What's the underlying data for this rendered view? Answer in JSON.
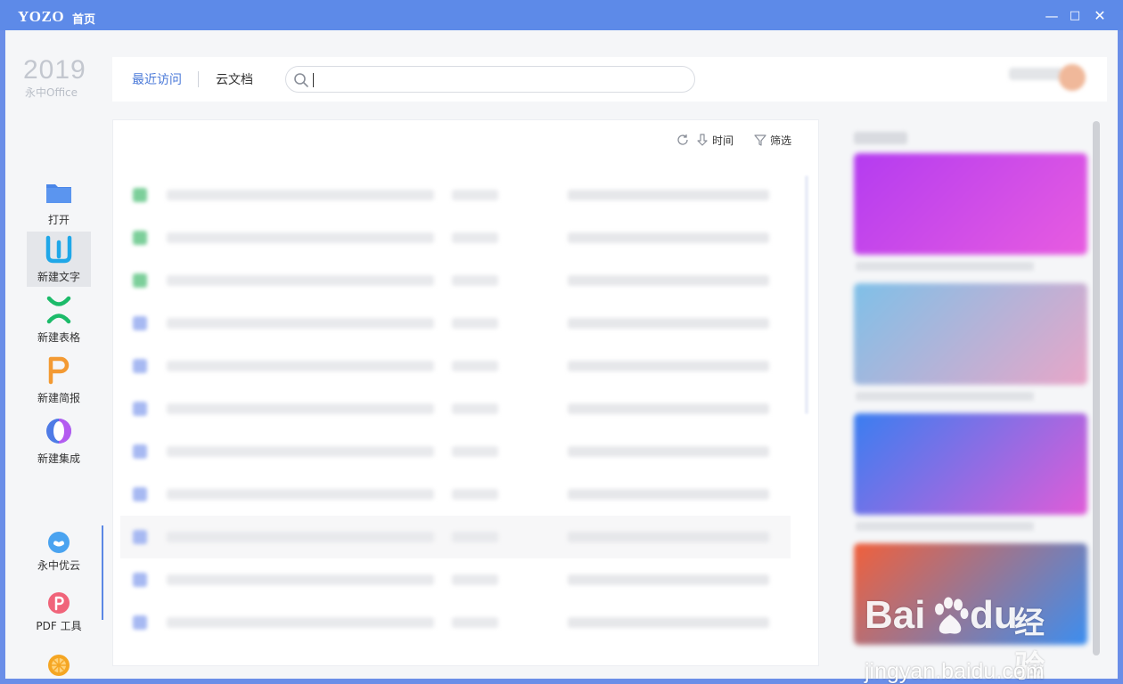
{
  "window": {
    "brand": "YOZO",
    "title": "首页",
    "controls": {
      "minimize": "—",
      "maximize": "□",
      "close": "✕"
    }
  },
  "logo": {
    "year": "2019",
    "product": "永中Office"
  },
  "sidebar": {
    "items": [
      {
        "label": "打开",
        "icon": "folder-icon",
        "color": "#4a86e8"
      },
      {
        "label": "新建文字",
        "icon": "word-w-icon",
        "color": "#1fa7e8",
        "active": true
      },
      {
        "label": "新建表格",
        "icon": "sheet-x-icon",
        "color": "#1cbb6a"
      },
      {
        "label": "新建简报",
        "icon": "slides-p-icon",
        "color": "#f39a33"
      },
      {
        "label": "新建集成",
        "icon": "integrated-icon",
        "color": "#4f7be6"
      }
    ],
    "cloud_items": [
      {
        "label": "永中优云",
        "icon": "cloud-icon",
        "color": "#4aa3f0"
      },
      {
        "label": "PDF 工具",
        "icon": "pdf-icon",
        "color": "#f0647a"
      },
      {
        "label": "",
        "icon": "orange-slice-icon",
        "color": "#f5a623"
      }
    ]
  },
  "header": {
    "tabs": [
      {
        "label": "最近访问",
        "active": true
      },
      {
        "label": "云文档",
        "active": false
      }
    ],
    "search": {
      "placeholder": "",
      "value": ""
    }
  },
  "file_list": {
    "sort": {
      "label": "时间",
      "icon": "sort-down-icon"
    },
    "filter": {
      "label": "筛选",
      "icon": "filter-icon"
    },
    "refresh_icon": "refresh-icon",
    "row_icon_colors": [
      "#7ccf9a",
      "#7ccf9a",
      "#7ccf9a",
      "#a7b9f2",
      "#a7b9f2",
      "#a7b9f2",
      "#a7b9f2",
      "#a7b9f2",
      "#a7b9f2",
      "#a7b9f2",
      "#a7b9f2"
    ]
  },
  "right_panel": {
    "banners": [
      {
        "gradient": [
          "#b43cf0",
          "#e85ce0"
        ]
      },
      {
        "gradient": [
          "#7fc0e8",
          "#e8a6c8"
        ]
      },
      {
        "gradient": [
          "#3a7ef0",
          "#e05cd8"
        ]
      },
      {
        "gradient": [
          "#f0603c",
          "#3c8ef0"
        ]
      }
    ]
  },
  "watermark": {
    "brand_left": "Bai",
    "brand_right": "du",
    "suffix": "经验",
    "url": "jingyan.baidu.com"
  }
}
